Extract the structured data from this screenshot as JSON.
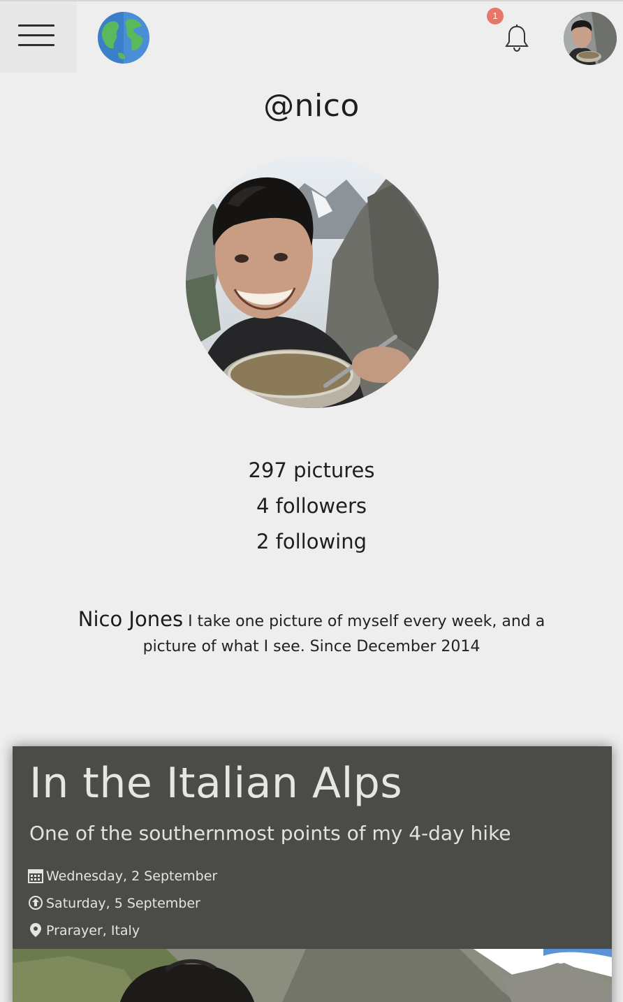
{
  "header": {
    "menu_icon": "hamburger-menu-icon",
    "logo_icon": "globe-icon",
    "notifications": {
      "icon": "bell-icon",
      "count": "1"
    },
    "user_avatar": "user-avatar"
  },
  "profile": {
    "handle": "@nico",
    "stats": {
      "pictures": "297 pictures",
      "followers": "4 followers",
      "following": "2 following"
    },
    "name": "Nico Jones",
    "bio": "I take one picture of myself every week, and a picture of what I see. Since December 2014"
  },
  "post": {
    "title": "In the Italian Alps",
    "subtitle": "One of the southernmost points of my 4-day hike",
    "date_start": "Wednesday, 2 September",
    "date_posted": "Saturday, 5 September",
    "location": "Prarayer, Italy"
  },
  "colors": {
    "background": "#efeeef",
    "card": "#4b4b47",
    "badge": "#e8776a",
    "text": "#1e1e1e"
  }
}
